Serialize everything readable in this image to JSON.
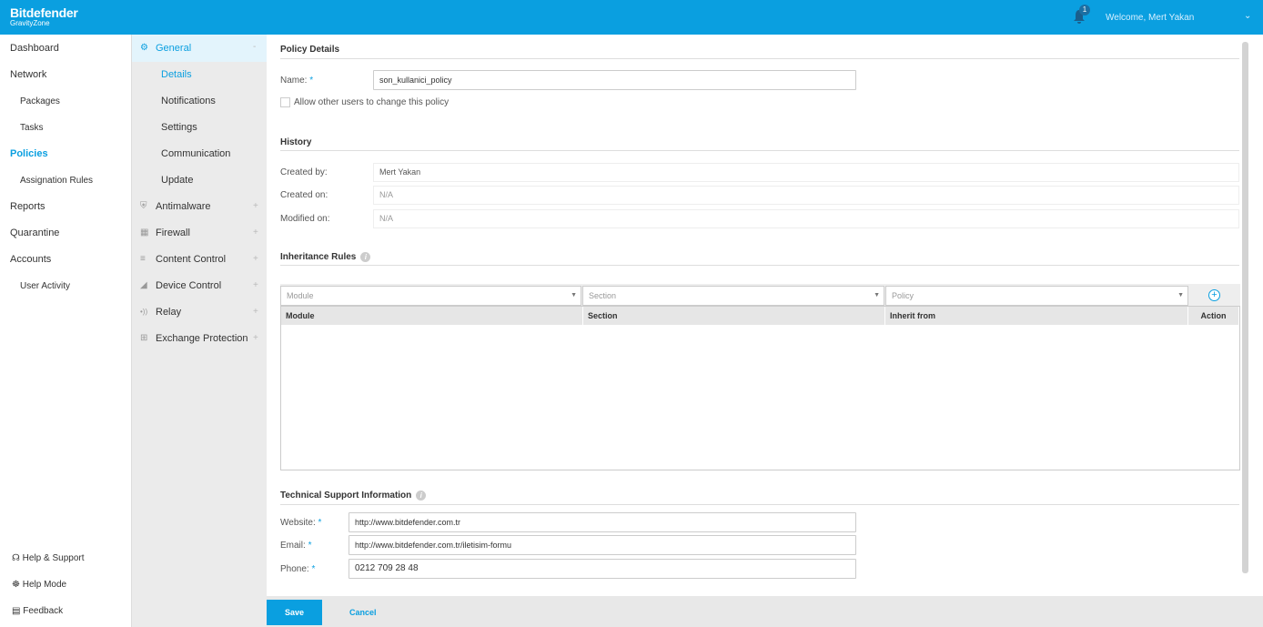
{
  "header": {
    "brand": "Bitdefender",
    "product": "GravityZone",
    "notifications": "1",
    "welcome": "Welcome, Mert Yakan"
  },
  "nav": {
    "items": [
      {
        "label": "Dashboard"
      },
      {
        "label": "Network"
      },
      {
        "label": "Packages"
      },
      {
        "label": "Tasks"
      },
      {
        "label": "Policies"
      },
      {
        "label": "Assignation Rules"
      },
      {
        "label": "Reports"
      },
      {
        "label": "Quarantine"
      },
      {
        "label": "Accounts"
      },
      {
        "label": "User Activity"
      }
    ],
    "bottom": [
      {
        "label": "Help & Support"
      },
      {
        "label": "Help Mode"
      },
      {
        "label": "Feedback"
      }
    ]
  },
  "policy_nav": {
    "general": "General",
    "general_items": [
      "Details",
      "Notifications",
      "Settings",
      "Communication",
      "Update"
    ],
    "modules": [
      "Antimalware",
      "Firewall",
      "Content Control",
      "Device Control",
      "Relay",
      "Exchange Protection"
    ]
  },
  "details": {
    "title": "Policy Details",
    "name_label": "Name:",
    "name_value": "son_kullanici_policy",
    "allow_label": "Allow other users to change this policy",
    "allow_checked": false
  },
  "history": {
    "title": "History",
    "created_by_label": "Created by:",
    "created_by": "Mert Yakan",
    "created_on_label": "Created on:",
    "created_on": "N/A",
    "modified_on_label": "Modified on:",
    "modified_on": "N/A"
  },
  "inheritance": {
    "title": "Inheritance Rules",
    "module_ph": "Module",
    "section_ph": "Section",
    "policy_ph": "Policy",
    "columns": [
      "Module",
      "Section",
      "Inherit from",
      "Action"
    ]
  },
  "support": {
    "title": "Technical Support Information",
    "website_label": "Website:",
    "website": "http://www.bitdefender.com.tr",
    "email_label": "Email:",
    "email": "http://www.bitdefender.com.tr/iletisim-formu",
    "phone_label": "Phone:",
    "phone": "0212 709 28 48"
  },
  "footer": {
    "save": "Save",
    "cancel": "Cancel"
  },
  "colors": {
    "accent": "#0a9fe0"
  }
}
